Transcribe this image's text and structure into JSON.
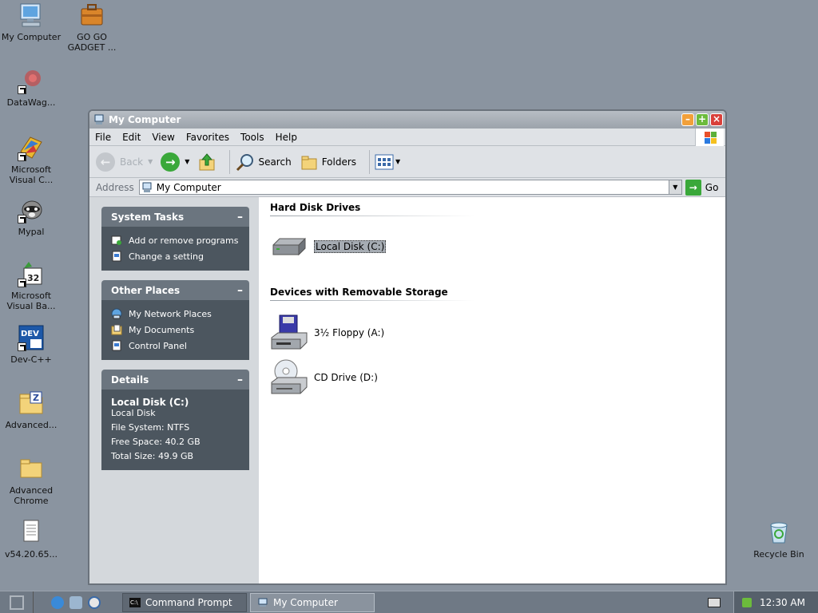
{
  "desktop": {
    "icons": [
      {
        "label": "My Computer"
      },
      {
        "label": "GO GO GADGET ..."
      },
      {
        "label": "DataWag..."
      },
      {
        "label": "Microsoft Visual C..."
      },
      {
        "label": "Mypal"
      },
      {
        "label": "Microsoft Visual Ba..."
      },
      {
        "label": "Dev-C++"
      },
      {
        "label": "Advanced..."
      },
      {
        "label": "Advanced Chrome"
      },
      {
        "label": "v54.20.65..."
      },
      {
        "label": "Recycle Bin"
      }
    ],
    "dev_icon_text": "DEV"
  },
  "window": {
    "title": "My Computer",
    "menu": [
      "File",
      "Edit",
      "View",
      "Favorites",
      "Tools",
      "Help"
    ],
    "toolbar": {
      "back": "Back",
      "search": "Search",
      "folders": "Folders"
    },
    "address": {
      "label": "Address",
      "value": "My Computer",
      "go": "Go"
    },
    "system_tasks": {
      "title": "System Tasks",
      "items": [
        "Add or remove programs",
        "Change a setting"
      ]
    },
    "other_places": {
      "title": "Other Places",
      "items": [
        "My Network Places",
        "My Documents",
        "Control Panel"
      ]
    },
    "details": {
      "title": "Details",
      "name": "Local Disk (C:)",
      "type": "Local Disk",
      "file_system": "File System: NTFS",
      "free_space": "Free Space: 40.2 GB",
      "total_size": "Total Size: 49.9 GB"
    },
    "sections": [
      {
        "title": "Hard Disk Drives",
        "items": [
          "Local Disk (C:)"
        ]
      },
      {
        "title": "Devices with Removable Storage",
        "items": [
          "3½ Floppy (A:)",
          "CD Drive (D:)"
        ]
      }
    ]
  },
  "taskbar": {
    "buttons": [
      "Command Prompt",
      "My Computer"
    ],
    "cmd_icon_text": "C:\\",
    "clock": "12:30 AM"
  }
}
